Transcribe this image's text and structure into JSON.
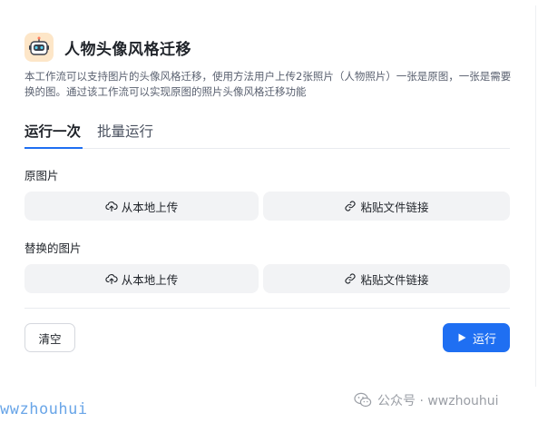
{
  "app": {
    "title": "人物头像风格迁移",
    "description": "本工作流可以支持图片的头像风格迁移，使用方法用户上传2张照片（人物照片）一张是原图，一张是需要换的图。通过该工作流可以实现原图的照片头像风格迁移功能",
    "icon": "robot-avatar-icon"
  },
  "tabs": [
    {
      "label": "运行一次",
      "active": true
    },
    {
      "label": "批量运行",
      "active": false
    }
  ],
  "fields": [
    {
      "label": "原图片",
      "upload_label": "从本地上传",
      "paste_label": "粘贴文件链接"
    },
    {
      "label": "替换的图片",
      "upload_label": "从本地上传",
      "paste_label": "粘贴文件链接"
    }
  ],
  "actions": {
    "clear_label": "清空",
    "run_label": "运行"
  },
  "watermark": {
    "left_text": "wwzhouhui",
    "right_text": "公众号 · wwzhouhui"
  },
  "colors": {
    "accent": "#1f6ff2",
    "button_bg": "#f2f3f5",
    "icon_bg": "#fde6c8"
  }
}
